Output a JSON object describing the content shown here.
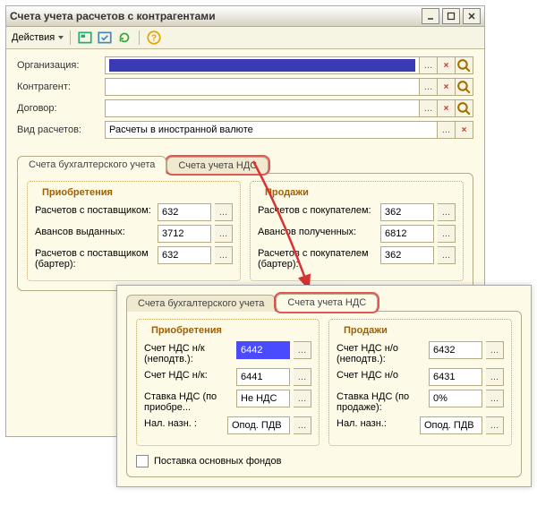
{
  "window1": {
    "title": "Счета учета расчетов с контрагентами",
    "toolbar": {
      "actions": "Действия"
    },
    "form": {
      "org_label": "Организация:",
      "cpty_label": "Контрагент:",
      "contract_label": "Договор:",
      "calc_type_label": "Вид расчетов:",
      "calc_type_value": "Расчеты в иностранной валюте"
    },
    "tabs": {
      "tab1": "Счета бухгалтерского учета",
      "tab2": "Счета учета НДС"
    },
    "pur": {
      "title": "Приобретения",
      "r1_label": "Расчетов с поставщиком:",
      "r1_val": "632",
      "r2_label": "Авансов выданных:",
      "r2_val": "3712",
      "r3_label": "Расчетов с поставщиком (бартер):",
      "r3_val": "632"
    },
    "sal": {
      "title": "Продажи",
      "r1_label": "Расчетов с покупателем:",
      "r1_val": "362",
      "r2_label": "Авансов полученных:",
      "r2_val": "6812",
      "r3_label": "Расчетов с покупателем (бартер):",
      "r3_val": "362"
    }
  },
  "window2": {
    "tabs": {
      "tab1": "Счета бухгалтерского учета",
      "tab2": "Счета учета НДС"
    },
    "pur": {
      "title": "Приобретения",
      "r1_label": "Счет НДС н/к (неподтв.):",
      "r1_val": "6442",
      "r2_label": "Счет НДС н/к:",
      "r2_val": "6441",
      "r3_label": "Ставка НДС (по приобре...",
      "r3_val": "Не НДС",
      "r4_label": "Нал. назн. :",
      "r4_val": "Опод. ПДВ"
    },
    "sal": {
      "title": "Продажи",
      "r1_label": "Счет НДС н/о (неподтв.):",
      "r1_val": "6432",
      "r2_label": "Счет НДС н/о",
      "r2_val": "6431",
      "r3_label": "Ставка НДС (по продаже):",
      "r3_val": "0%",
      "r4_label": "Нал. назн.:",
      "r4_val": "Опод. ПДВ"
    },
    "checkbox": "Поставка основных фондов"
  }
}
